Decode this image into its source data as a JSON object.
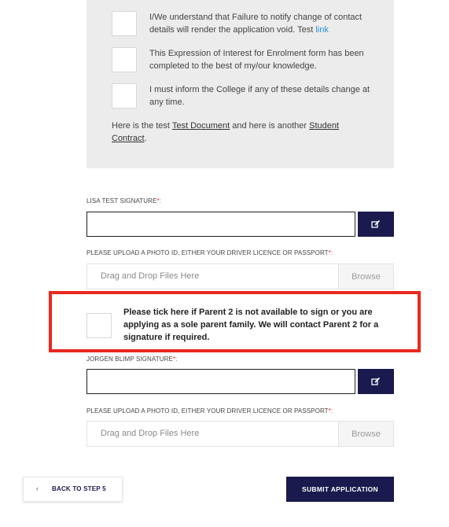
{
  "declarations": {
    "items": [
      {
        "text": "I/We understand that Failure to notify change of contact details will render the application void. Test ",
        "link": "link"
      },
      {
        "text": "This Expression of Interest for Enrolment form has been completed to the best of my/our knowledge."
      },
      {
        "text": "I must inform the College if any of these details change at any time."
      }
    ],
    "doc_note": {
      "prefix": "Here is the test ",
      "doc1": "Test Document",
      "middle": " and here is another ",
      "doc2": "Student Contract",
      "suffix": "."
    }
  },
  "signature1": {
    "label": "LISA TEST SIGNATURE",
    "required_mark": "*:",
    "edit_icon": "edit-icon"
  },
  "upload1": {
    "label": "PLEASE UPLOAD A PHOTO ID, EITHER YOUR DRIVER LICENCE OR PASSPORT",
    "required_mark": "*:",
    "drop_text": "Drag and Drop Files Here",
    "browse_label": "Browse"
  },
  "parent2": {
    "text": "Please tick here if Parent 2 is not available to sign or you are applying as a sole parent family. We will contact Parent 2 for a signature if required."
  },
  "signature2": {
    "label": "JORGEN BLIMP SIGNATURE",
    "required_mark": "*:",
    "edit_icon": "edit-icon"
  },
  "upload2": {
    "label": "PLEASE UPLOAD A PHOTO ID, EITHER YOUR DRIVER LICENCE OR PASSPORT",
    "required_mark": "*:",
    "drop_text": "Drag and Drop Files Here",
    "browse_label": "Browse"
  },
  "nav": {
    "back_chevron": "‹",
    "back_label": "BACK TO STEP 5",
    "submit_label": "SUBMIT APPLICATION"
  },
  "colors": {
    "primary": "#1a1a4e",
    "required": "#e02020",
    "highlight": "#e8281f",
    "link": "#2a8fd6",
    "panel": "#ececec"
  }
}
